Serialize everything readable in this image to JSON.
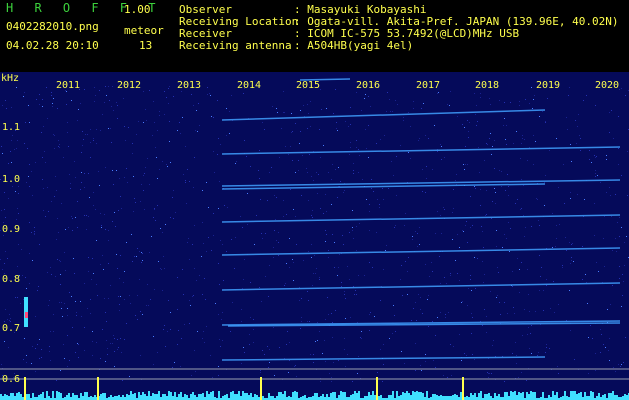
{
  "app": {
    "name": "H R O F F T",
    "version": "1.00"
  },
  "capture": {
    "filename": "0402282010.png",
    "datetime": "04.02.28 20:10",
    "meteor_label": "meteor",
    "meteor_count": "13"
  },
  "info": [
    {
      "key": "Observer",
      "value": ": Masayuki Kobayashi"
    },
    {
      "key": "Receiving Location",
      "value": ": Ogata-vill. Akita-Pref. JAPAN (139.96E, 40.02N)"
    },
    {
      "key": "Receiver",
      "value": ": ICOM IC-575 53.7492(@LCD)MHz USB"
    },
    {
      "key": "Receiving antenna",
      "value": ": A504HB(yagi 4el)"
    }
  ],
  "axis": {
    "unit": "kHz",
    "y_ticks": [
      "1.1",
      "1.0",
      "0.9",
      "0.8",
      "0.7",
      "0.6"
    ],
    "x_ticks": [
      "2011",
      "2012",
      "2013",
      "2014",
      "2015",
      "2016",
      "2017",
      "2018",
      "2019",
      "2020"
    ]
  },
  "colors": {
    "header_green": "#3cd13c",
    "header_yellow": "#ffff4d",
    "spectrogram_bg": "#050a5a",
    "trace": "#40a0ff",
    "signal_cyan": "#40e0ff"
  }
}
